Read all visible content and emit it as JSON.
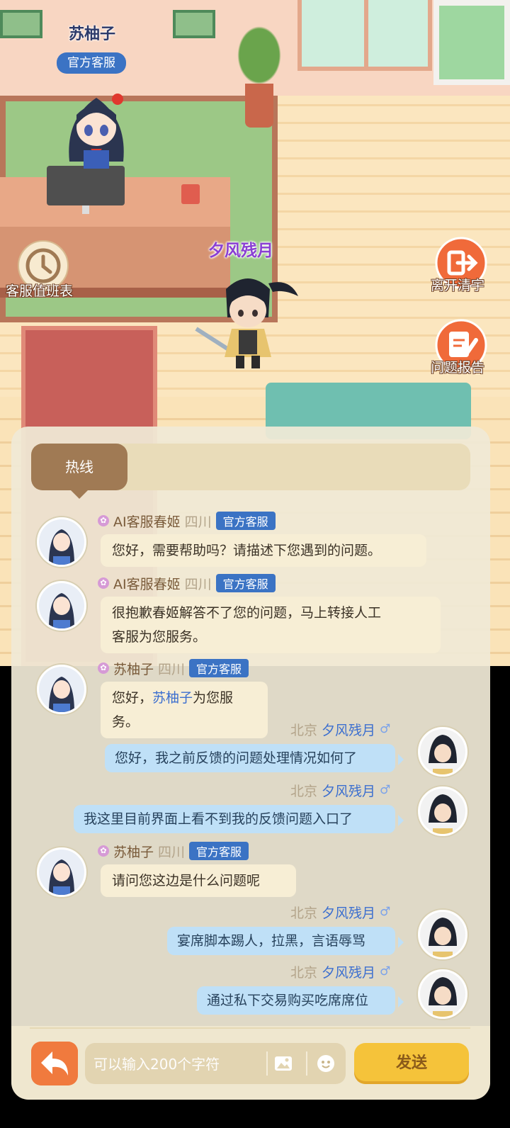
{
  "scene": {
    "npc_name": "苏柚子",
    "npc_badge": "官方客服",
    "player_name": "夕风残月",
    "schedule_label": "客服值班表",
    "leave_label": "离开清宇",
    "report_label": "问题报告"
  },
  "chat": {
    "tab_hotline": "热线",
    "messages": [
      {
        "side": "left",
        "name": "AI客服春姬",
        "location": "四川",
        "badge": "官方客服",
        "text": "您好，需要帮助吗？请描述下您遇到的问题。"
      },
      {
        "side": "left",
        "name": "AI客服春姬",
        "location": "四川",
        "badge": "官方客服",
        "text_line1": "很抱歉春姬解答不了您的问题，马上转接人工",
        "text_line2": "客服为您服务。"
      },
      {
        "side": "left",
        "name": "苏柚子",
        "location": "四川",
        "badge": "官方客服",
        "text_pre": "您好，",
        "text_highlight": "苏柚子",
        "text_post": "为您服务。"
      },
      {
        "side": "right",
        "location": "北京",
        "name": "夕风残月",
        "gender": "♂",
        "text": "您好，我之前反馈的问题处理情况如何了"
      },
      {
        "side": "right",
        "location": "北京",
        "name": "夕风残月",
        "gender": "♂",
        "text": "我这里目前界面上看不到我的反馈问题入口了"
      },
      {
        "side": "left",
        "name": "苏柚子",
        "location": "四川",
        "badge": "官方客服",
        "text": "请问您这边是什么问题呢"
      },
      {
        "side": "right",
        "location": "北京",
        "name": "夕风残月",
        "gender": "♂",
        "text": "宴席脚本踢人，拉黑，言语辱骂"
      },
      {
        "side": "right",
        "location": "北京",
        "name": "夕风残月",
        "gender": "♂",
        "text": "通过私下交易购买吃席席位"
      }
    ]
  },
  "input": {
    "placeholder": "可以输入200个字符",
    "send_label": "发送"
  },
  "colors": {
    "badge_blue": "#3b73c4",
    "send_yellow": "#f5c33a",
    "back_orange": "#f07a3e",
    "player_name_purple": "#8a3fd3"
  }
}
